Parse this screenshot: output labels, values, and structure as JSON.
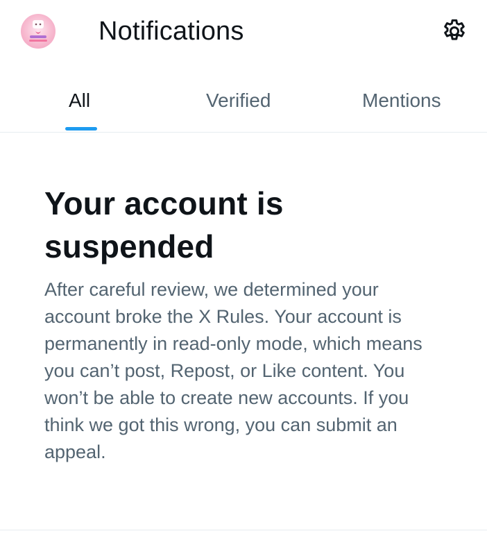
{
  "header": {
    "title": "Notifications",
    "avatar_icon": "user-avatar",
    "settings_icon": "gear-icon"
  },
  "tabs": [
    {
      "label": "All",
      "active": true
    },
    {
      "label": "Verified",
      "active": false
    },
    {
      "label": "Mentions",
      "active": false
    }
  ],
  "notice": {
    "title": "Your account is suspended",
    "body": "After careful review, we determined your account broke the X Rules. Your account is permanently in read-only mode, which means you can’t post, Repost, or Like content. You won’t be able to create new accounts. If you think we got this wrong, you can submit an appeal."
  },
  "colors": {
    "accent": "#1d9bf0",
    "primary_text": "#0f1419",
    "secondary_text": "#536471",
    "divider": "#e6ecf0",
    "avatar_bg": "#f7b9cf"
  }
}
